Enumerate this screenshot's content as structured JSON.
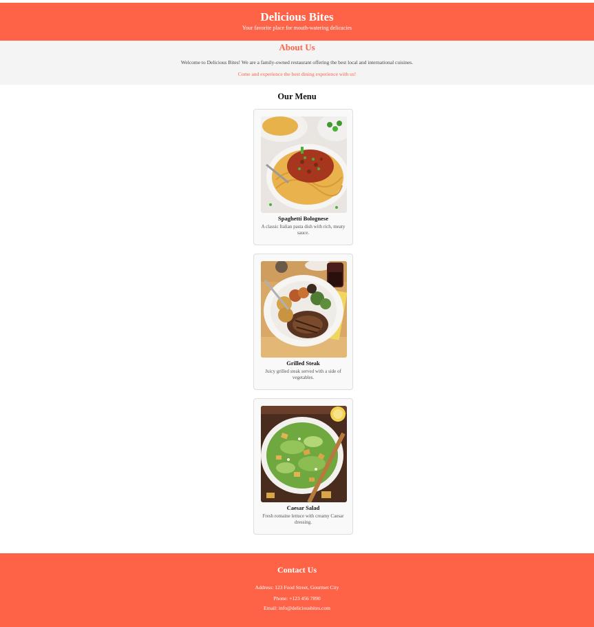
{
  "header": {
    "title": "Delicious Bites",
    "tagline": "Your favorite place for mouth-watering delicacies"
  },
  "about": {
    "title": "About Us",
    "text": "Welcome to Delicious Bites! We are a family-owned restaurant offering the best local and international cuisines.",
    "cta": "Come and experience the best dining experience with us!"
  },
  "menu": {
    "title": "Our Menu",
    "items": [
      {
        "name": "Spaghetti Bolognese",
        "description": "A classic Italian pasta dish with rich, meaty sauce.",
        "image": "spaghetti-bolognese-photo"
      },
      {
        "name": "Grilled Steak",
        "description": "Juicy grilled steak served with a side of vegetables.",
        "image": "grilled-steak-photo"
      },
      {
        "name": "Caesar Salad",
        "description": "Fresh romaine lettuce with creamy Caesar dressing.",
        "image": "caesar-salad-photo"
      }
    ]
  },
  "footer": {
    "title": "Contact Us",
    "address": "Address: 123 Food Street, Gourmet City",
    "phone": "Phone: +123 456 7890",
    "email": "Email: info@deliciousbites.com"
  },
  "colors": {
    "accent": "#ff6347",
    "about_bg": "#f4f4f4",
    "card_bg": "#f9f9f9"
  }
}
